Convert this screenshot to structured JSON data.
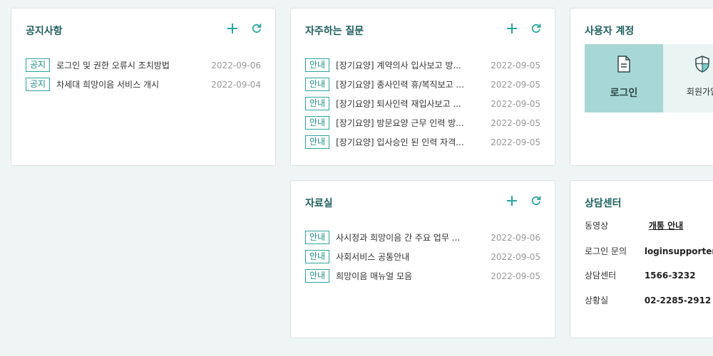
{
  "notice": {
    "title": "공지사항",
    "items": [
      {
        "badge": "공지",
        "text": "로그인 및 권한 오류시 조치방법",
        "date": "2022-09-06"
      },
      {
        "badge": "공지",
        "text": "차세대 희망이음 서비스 개시",
        "date": "2022-09-04"
      }
    ]
  },
  "faq": {
    "title": "자주하는 질문",
    "items": [
      {
        "badge": "안내",
        "text": "[장기요양] 계약의사 입사보고 방...",
        "date": "2022-09-05"
      },
      {
        "badge": "안내",
        "text": "[장기요양] 종사인력 휴/복직보고 ...",
        "date": "2022-09-05"
      },
      {
        "badge": "안내",
        "text": "[장기요양] 퇴사인력 재입사보고 ...",
        "date": "2022-09-05"
      },
      {
        "badge": "안내",
        "text": "[장기요양] 방문요양 근무 인력 방...",
        "date": "2022-09-05"
      },
      {
        "badge": "안내",
        "text": "[장기요양] 입사승인 된 인력 자격...",
        "date": "2022-09-05"
      }
    ]
  },
  "account": {
    "title": "사용자 계정",
    "login_label": "로그인",
    "join_label": "회원가입"
  },
  "library": {
    "title": "자료실",
    "items": [
      {
        "badge": "안내",
        "text": "사시정과 희망이음 간 주요 업무 ...",
        "date": "2022-09-06"
      },
      {
        "badge": "안내",
        "text": "사회서비스 공통안내",
        "date": "2022-09-05"
      },
      {
        "badge": "안내",
        "text": "희망이음 매뉴얼 모음",
        "date": "2022-09-05"
      }
    ]
  },
  "support": {
    "title": "상담센터",
    "video_label": "동영상",
    "video_link": "개통 안내",
    "login_inquiry_label": "로그인 문의",
    "login_inquiry_value": "loginsupporter@",
    "center_label": "상담센터",
    "center_value": "1566-3232",
    "room_label": "상황실",
    "room_value": "02-2285-2912"
  },
  "colors": {
    "accent": "#2aa5a0",
    "title": "#1e5f5c",
    "background": "#eef5f4"
  },
  "icons": {
    "add": "plus-icon",
    "refresh": "refresh-icon",
    "login": "document-icon",
    "join": "shield-icon"
  }
}
